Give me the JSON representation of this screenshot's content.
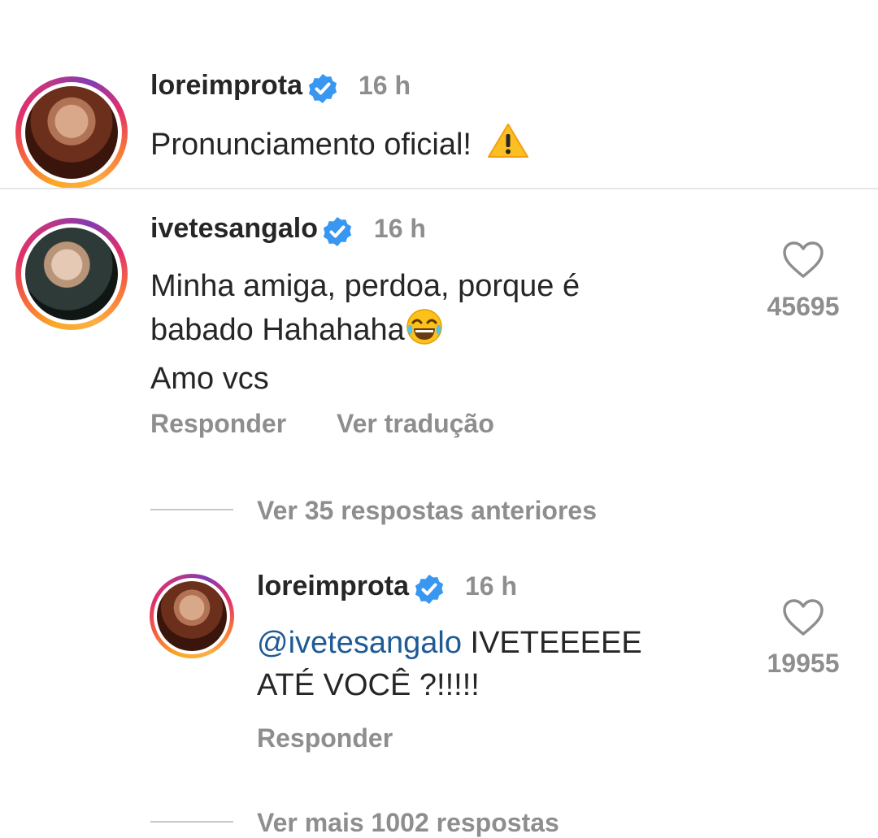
{
  "post": {
    "username": "loreimprota",
    "time": "16 h",
    "caption": "Pronunciamento oficial!",
    "caption_emoji": "warning-icon"
  },
  "comment": {
    "username": "ivetesangalo",
    "time": "16 h",
    "lines": [
      "Minha amiga, perdoa, porque é",
      "babado Hahahaha",
      "Amo vcs"
    ],
    "emoji": "joy-emoji",
    "likes": "45695",
    "reply_label": "Responder",
    "translate_label": "Ver tradução",
    "view_previous": "Ver 35 respostas anteriores"
  },
  "reply": {
    "username": "loreimprota",
    "time": "16 h",
    "mention": "@ivetesangalo",
    "text_line1": "IVETEEEEE",
    "text_line2": "ATÉ VOCÊ ?!!!!!",
    "likes": "19955",
    "reply_label": "Responder",
    "view_more": "Ver mais 1002 respostas"
  },
  "colors": {
    "verified": "#3897f0",
    "muted": "#8e8e8e",
    "mention": "#1e5a96"
  }
}
